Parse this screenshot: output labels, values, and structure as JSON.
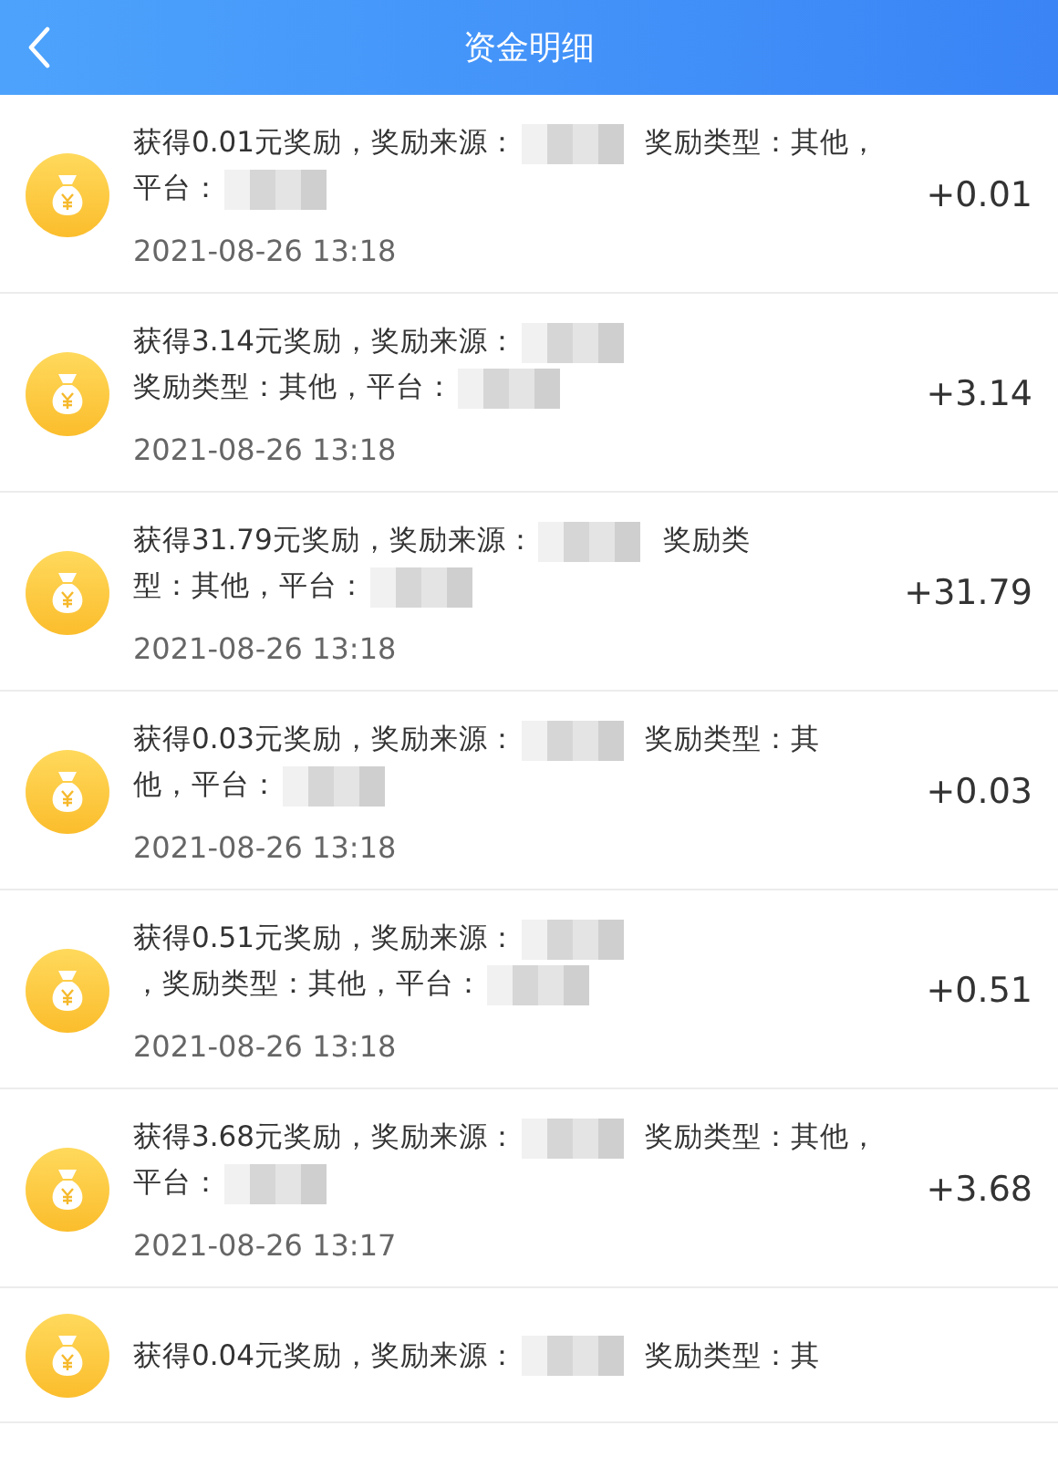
{
  "header": {
    "back_icon": true,
    "title": "资金明细"
  },
  "records": [
    {
      "parts": [
        {
          "kind": "text",
          "text": "获得0.01元奖励，奖励来源："
        },
        {
          "kind": "redacted"
        },
        {
          "kind": "text",
          "text": "奖励类型：其他，"
        },
        {
          "kind": "text",
          "text": "平台："
        },
        {
          "kind": "redacted"
        }
      ],
      "date": "2021-08-26 13:18",
      "amount": "+0.01"
    },
    {
      "parts": [
        {
          "kind": "text",
          "text": "获得3.14元奖励，奖励来源："
        },
        {
          "kind": "redacted"
        },
        {
          "kind": "text",
          "text": "奖励类型：其他，平"
        },
        {
          "kind": "text",
          "text": "台："
        },
        {
          "kind": "redacted"
        }
      ],
      "date": "2021-08-26 13:18",
      "amount": "+3.14"
    },
    {
      "parts": [
        {
          "kind": "text",
          "text": "获得31.79元奖励，奖励来源："
        },
        {
          "kind": "redacted"
        },
        {
          "kind": "text",
          "text": "奖励类"
        },
        {
          "kind": "text",
          "text": "型：其他，平台："
        },
        {
          "kind": "redacted"
        }
      ],
      "date": "2021-08-26 13:18",
      "amount": "+31.79"
    },
    {
      "parts": [
        {
          "kind": "text",
          "text": "获得0.03元奖励，奖励来源："
        },
        {
          "kind": "redacted"
        },
        {
          "kind": "text",
          "text": "奖励类型：其"
        },
        {
          "kind": "text",
          "text": "他，平台："
        },
        {
          "kind": "redacted"
        }
      ],
      "date": "2021-08-26 13:18",
      "amount": "+0.03"
    },
    {
      "parts": [
        {
          "kind": "text",
          "text": "获得0.51元奖励，奖励来源："
        },
        {
          "kind": "redacted"
        },
        {
          "kind": "text",
          "text": "，奖励类型：其他，"
        },
        {
          "kind": "text",
          "text": "平台："
        },
        {
          "kind": "redacted"
        }
      ],
      "date": "2021-08-26 13:18",
      "amount": "+0.51"
    },
    {
      "parts": [
        {
          "kind": "text",
          "text": "获得3.68元奖励，奖励来源："
        },
        {
          "kind": "redacted"
        },
        {
          "kind": "text",
          "text": "奖励类型：其他，"
        },
        {
          "kind": "text",
          "text": "平台："
        },
        {
          "kind": "redacted"
        }
      ],
      "date": "2021-08-26 13:17",
      "amount": "+3.68"
    },
    {
      "parts": [
        {
          "kind": "text",
          "text": "获得0.04元奖励，奖励来源："
        },
        {
          "kind": "redacted"
        },
        {
          "kind": "text",
          "text": "奖励类型：其"
        }
      ]
    }
  ]
}
